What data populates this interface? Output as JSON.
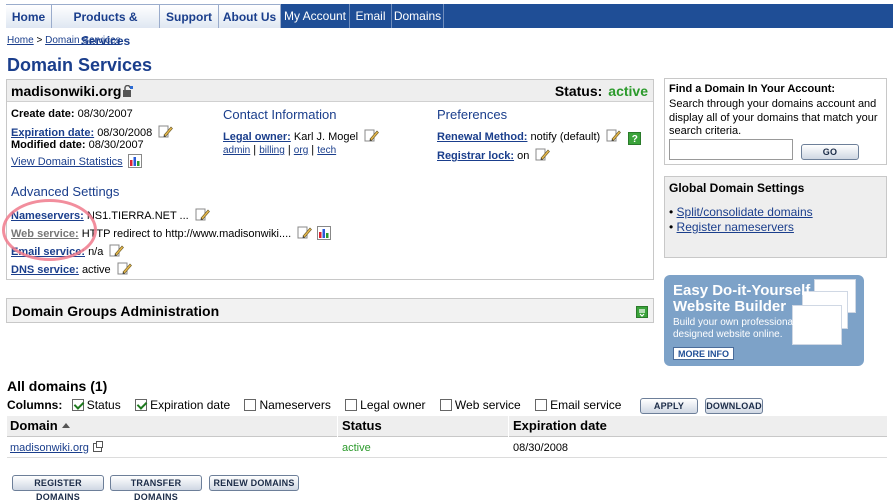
{
  "nav": {
    "tabs": [
      {
        "label": "Home"
      },
      {
        "label": "Products & Services"
      },
      {
        "label": "Support"
      },
      {
        "label": "About Us"
      },
      {
        "label": "My Account"
      },
      {
        "label": "Email"
      },
      {
        "label": "Domains"
      }
    ]
  },
  "breadcrumb": {
    "home": "Home",
    "sep": ">",
    "current": "Domain Services"
  },
  "page_title": "Domain Services",
  "domain": {
    "name": "madisonwiki.org",
    "status_label": "Status:",
    "status_value": "active",
    "create_label": "Create date:",
    "create_value": "08/30/2007",
    "expiration_label": "Expiration date:",
    "expiration_value": "08/30/2008",
    "modified_label": "Modified date:",
    "modified_value": "08/30/2007",
    "view_stats": "View Domain Statistics",
    "contact_title": "Contact Information",
    "legal_owner_label": "Legal owner:",
    "legal_owner_value": "Karl J. Mogel",
    "contact_links": [
      "admin",
      "billing",
      "org",
      "tech"
    ],
    "prefs_title": "Preferences",
    "renewal_label": "Renewal Method:",
    "renewal_value": "notify (default)",
    "registrar_label": "Registrar lock:",
    "registrar_value": "on",
    "help_glyph": "?",
    "advanced_title": "Advanced Settings",
    "nameservers_label": "Nameservers:",
    "nameservers_value": "NS1.TIERRA.NET ...",
    "web_label": "Web service:",
    "web_value": "HTTP redirect to http://www.madisonwiki....",
    "email_label": "Email service:",
    "email_value": "n/a",
    "dns_label": "DNS service:",
    "dns_value": "active"
  },
  "groups_title": "Domain Groups Administration",
  "find": {
    "title": "Find a Domain In Your Account:",
    "desc": "Search through your domains account and display all of your domains that match your search criteria.",
    "input_value": "",
    "go": "GO"
  },
  "global": {
    "title": "Global Domain Settings",
    "links": [
      "Split/consolidate domains",
      "Register nameservers"
    ]
  },
  "promo": {
    "line1": "Easy Do-it-Yourself",
    "line2": "Website Builder",
    "body1": "Build your own professionally",
    "body2": "designed website online.",
    "more": "MORE INFO"
  },
  "all_domains": {
    "title": "All domains (1)",
    "columns_label": "Columns:",
    "options": [
      {
        "label": "Status",
        "checked": true
      },
      {
        "label": "Expiration date",
        "checked": true
      },
      {
        "label": "Nameservers",
        "checked": false
      },
      {
        "label": "Legal owner",
        "checked": false
      },
      {
        "label": "Web service",
        "checked": false
      },
      {
        "label": "Email service",
        "checked": false
      }
    ],
    "apply": "APPLY",
    "download": "DOWNLOAD",
    "headers": [
      "Domain",
      "Status",
      "Expiration date"
    ],
    "rows": [
      {
        "domain": "madisonwiki.org",
        "status": "active",
        "expiration": "08/30/2008"
      }
    ]
  },
  "bottom_buttons": [
    "REGISTER DOMAINS",
    "TRANSFER DOMAINS",
    "RENEW DOMAINS"
  ],
  "colors": {
    "nav": "#1f4e96",
    "link": "#1a3e8c",
    "active": "#2b9a2b",
    "annotation": "#f07a8c"
  }
}
